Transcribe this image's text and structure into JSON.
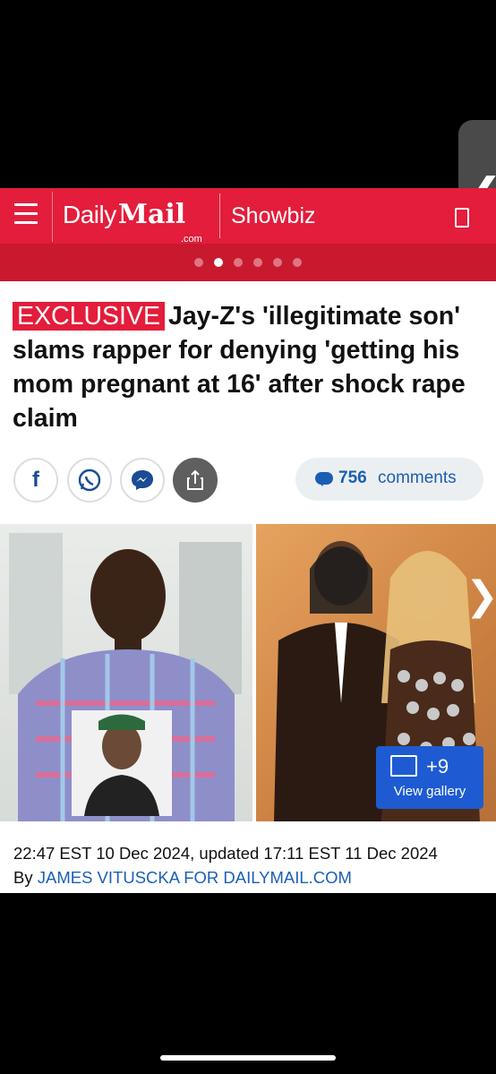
{
  "header": {
    "brand_daily": "Daily",
    "brand_mail": "Mail",
    "brand_com": ".com",
    "section": "Showbiz",
    "menu_icon": "hamburger-icon",
    "accent": "#e31d3b"
  },
  "carousel": {
    "dot_count": 6,
    "active_index": 1
  },
  "article": {
    "badge": "EXCLUSIVE",
    "headline": "Jay-Z's 'illegitimate son' slams rapper for denying 'getting his mom pregnant at 16' after shock rape claim",
    "share": {
      "facebook_label": "f",
      "whatsapp_icon": "whatsapp-icon",
      "messenger_icon": "messenger-icon",
      "share_icon": "share-icon"
    },
    "comments": {
      "count": "756",
      "label": "comments"
    },
    "gallery": {
      "count": "+9",
      "label": "View gallery"
    },
    "dateline": "22:47 EST 10 Dec 2024, updated 17:11 EST 11 Dec 2024",
    "byline_prefix": "By",
    "author": "JAMES VITUSCKA FOR DAILYMAIL.COM"
  }
}
